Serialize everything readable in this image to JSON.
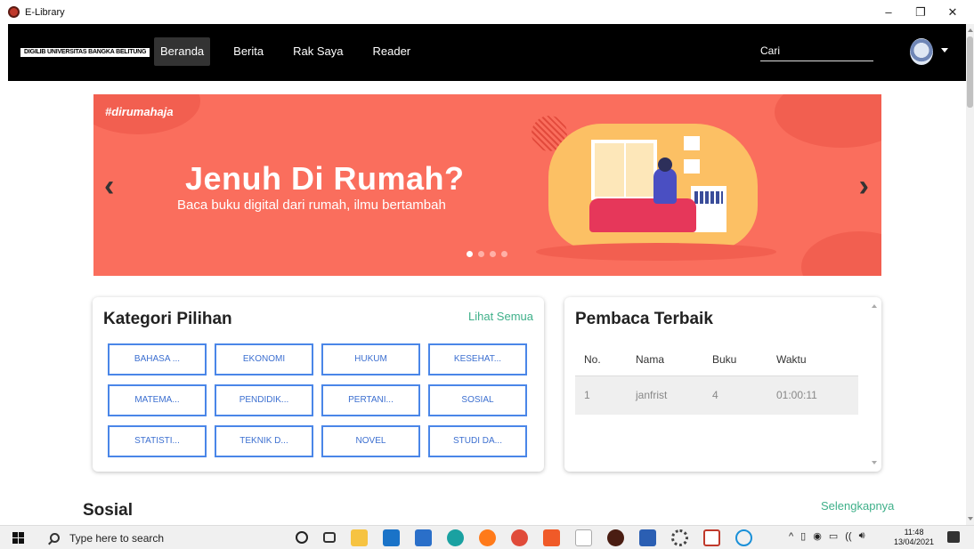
{
  "window": {
    "title": "E-Library",
    "controls": [
      "–",
      "❐",
      "✕"
    ]
  },
  "navbar": {
    "brand": "DIGILIB UNIVERSITAS BANGKA BELITUNG",
    "links": [
      "Beranda",
      "Berita",
      "Rak Saya",
      "Reader"
    ],
    "active_link": "Beranda",
    "search_placeholder": "Cari",
    "avatar_icon": "university-logo-icon",
    "menu_icon": "caret-down-icon"
  },
  "banner": {
    "hashtag": "#dirumahaja",
    "headline": "Jenuh Di Rumah?",
    "subline": "Baca buku digital dari rumah, ilmu bertambah",
    "prev_icon": "‹",
    "next_icon": "›",
    "slide_count": 4,
    "active_slide": 1,
    "background_color": "#fa6e5d"
  },
  "kategori": {
    "title": "Kategori Pilihan",
    "see_all": "Lihat Semua",
    "categories": [
      "BAHASA ...",
      "EKONOMI",
      "HUKUM",
      "KESEHAT...",
      "MATEMA...",
      "PENDIDIK...",
      "PERTANI...",
      "SOSIAL",
      "STATISTI...",
      "TEKNIK D...",
      "NOVEL",
      "STUDI DA..."
    ],
    "accent_color": "#4a86e8"
  },
  "pembaca": {
    "title": "Pembaca Terbaik",
    "columns": [
      "No.",
      "Nama",
      "Buku",
      "Waktu"
    ],
    "rows": [
      [
        "1",
        "janfrist",
        "4",
        "01:00:11"
      ]
    ]
  },
  "sosial": {
    "title": "Sosial",
    "more_link": "Selengkapnya",
    "link_color": "#3fb08a"
  },
  "taskbar": {
    "search_placeholder": "Type here to search",
    "time": "11:48",
    "date": "13/04/2021",
    "pinned_icons": [
      "cortana-icon",
      "task-view-icon",
      "file-explorer-icon",
      "mail-icon",
      "store-icon",
      "edge-icon",
      "firefox-icon",
      "chrome-icon",
      "app-icon",
      "document-icon",
      "elibrary-icon",
      "word-icon",
      "settings-icon",
      "chart-app-icon",
      "ie-icon"
    ],
    "tray_icons": [
      "^",
      "▯",
      "◉",
      "▭",
      "((",
      "🔊︎"
    ]
  }
}
